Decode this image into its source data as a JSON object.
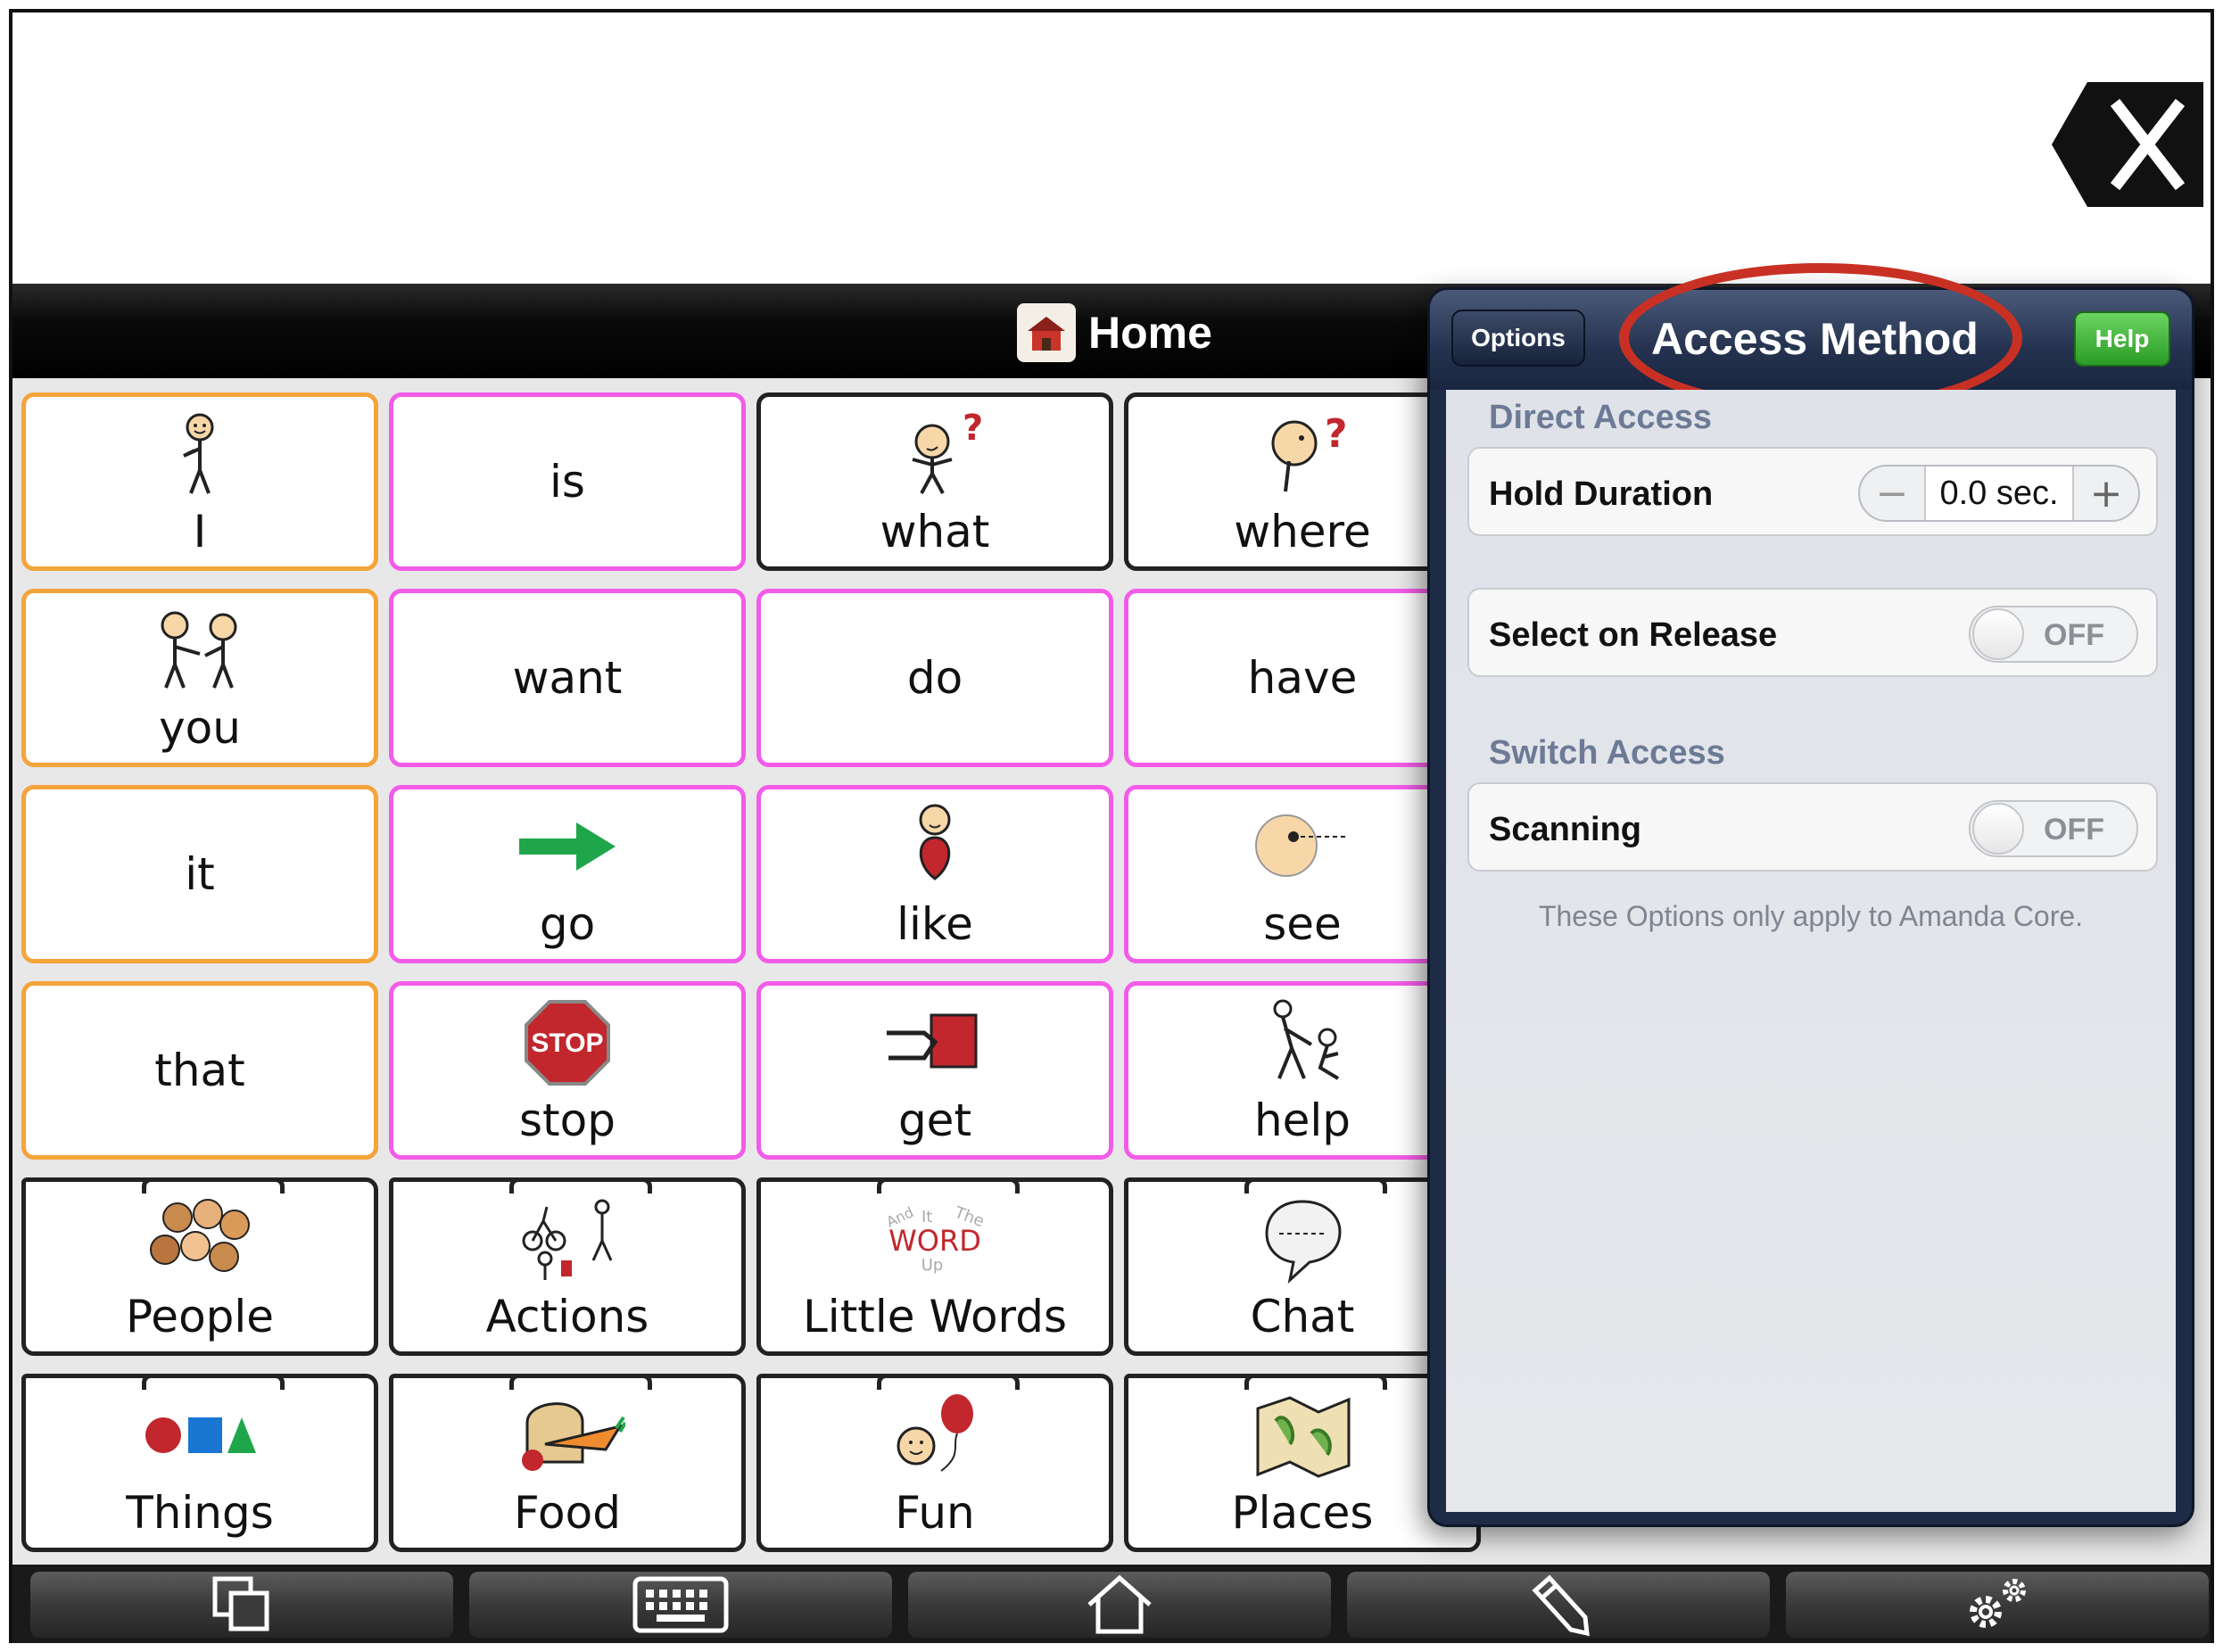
{
  "board": {
    "title": "Home",
    "cells": [
      {
        "word": "I",
        "icon": "person-pointing-self-icon",
        "style": "orange"
      },
      {
        "word": "is",
        "icon": "",
        "style": "pink"
      },
      {
        "word": "what",
        "icon": "question-person-icon",
        "style": "plain"
      },
      {
        "word": "where",
        "icon": "question-head-icon",
        "style": "plain"
      },
      {
        "word": "you",
        "icon": "person-pointing-other-icon",
        "style": "orange"
      },
      {
        "word": "want",
        "icon": "",
        "style": "pink"
      },
      {
        "word": "do",
        "icon": "",
        "style": "pink"
      },
      {
        "word": "have",
        "icon": "",
        "style": "pink"
      },
      {
        "word": "it",
        "icon": "",
        "style": "orange"
      },
      {
        "word": "go",
        "icon": "green-arrow-icon",
        "style": "pink"
      },
      {
        "word": "like",
        "icon": "heart-person-icon",
        "style": "pink"
      },
      {
        "word": "see",
        "icon": "eye-face-icon",
        "style": "pink"
      },
      {
        "word": "that",
        "icon": "",
        "style": "orange"
      },
      {
        "word": "stop",
        "icon": "stop-sign-icon",
        "style": "pink"
      },
      {
        "word": "get",
        "icon": "hand-grab-box-icon",
        "style": "pink"
      },
      {
        "word": "help",
        "icon": "helping-people-icon",
        "style": "pink"
      },
      {
        "word": "People",
        "icon": "group-faces-icon",
        "style": "folder"
      },
      {
        "word": "Actions",
        "icon": "actions-figures-icon",
        "style": "folder"
      },
      {
        "word": "Little Words",
        "icon": "word-cloud-icon",
        "style": "folder",
        "art": {
          "big": "WORD",
          "small": [
            "And",
            "It",
            "The",
            "Up"
          ]
        }
      },
      {
        "word": "Chat",
        "icon": "speech-bubble-icon",
        "style": "folder"
      },
      {
        "word": "Things",
        "icon": "shapes-icon",
        "style": "folder"
      },
      {
        "word": "Food",
        "icon": "food-bread-carrot-icon",
        "style": "folder"
      },
      {
        "word": "Fun",
        "icon": "balloon-face-icon",
        "style": "folder"
      },
      {
        "word": "Places",
        "icon": "map-icon",
        "style": "folder"
      }
    ]
  },
  "popover": {
    "options_label": "Options",
    "title": "Access Method",
    "help_label": "Help",
    "direct_access_header": "Direct Access",
    "hold_duration_label": "Hold Duration",
    "hold_duration_value": "0.0 sec.",
    "select_on_release_label": "Select on Release",
    "select_on_release_state": "OFF",
    "switch_access_header": "Switch Access",
    "scanning_label": "Scanning",
    "scanning_state": "OFF",
    "footnote": "These Options only apply to Amanda Core."
  },
  "toolbar": {
    "buttons": [
      "copy-pages-icon",
      "keyboard-icon",
      "home-outline-icon",
      "pencil-icon",
      "gears-icon"
    ]
  },
  "colors": {
    "core_border": "#f3a43a",
    "verb_border": "#f25ce8",
    "highlight_ring": "#c93024",
    "help_button": "#2a9c26"
  }
}
